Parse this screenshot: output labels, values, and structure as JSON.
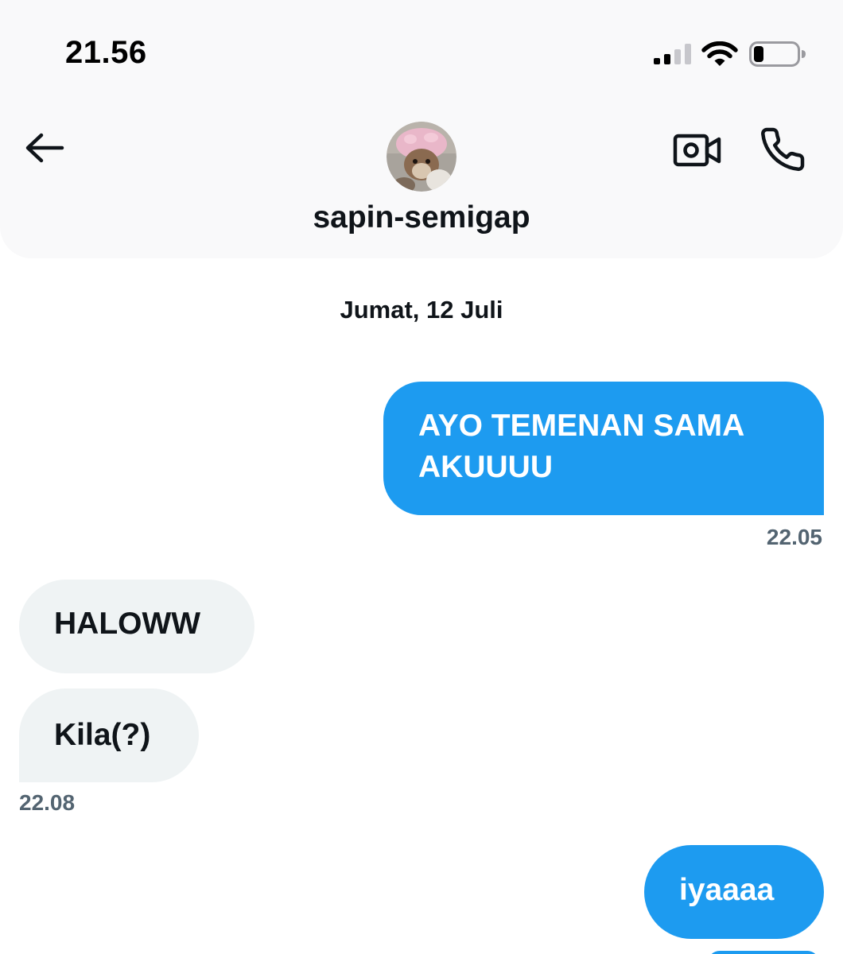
{
  "status_bar": {
    "time": "21.56",
    "icons": [
      "cellular-signal-icon",
      "wifi-icon",
      "battery-icon"
    ]
  },
  "header": {
    "back_icon": "arrow-left-icon",
    "avatar": "cat-avatar",
    "name": "sapin-semigap",
    "video_icon": "video-camera-icon",
    "call_icon": "phone-icon"
  },
  "chat": {
    "date": "Jumat, 12 Juli",
    "messages": [
      {
        "direction": "outgoing",
        "lines": [
          "AYO TEMENAN SAMA",
          "AKUUUU"
        ]
      },
      {
        "direction": "incoming",
        "text": "HALOWW"
      },
      {
        "direction": "incoming",
        "text": "Kila(?)"
      },
      {
        "direction": "outgoing",
        "text": "iyaaaa"
      }
    ],
    "timestamps": [
      "22.05",
      "22.08"
    ]
  },
  "colors": {
    "accent": "#1d9bf0",
    "incoming_bubble": "#eff3f4",
    "text": "#0f1419",
    "muted": "#536471",
    "header_bg": "#f9f9fa"
  }
}
